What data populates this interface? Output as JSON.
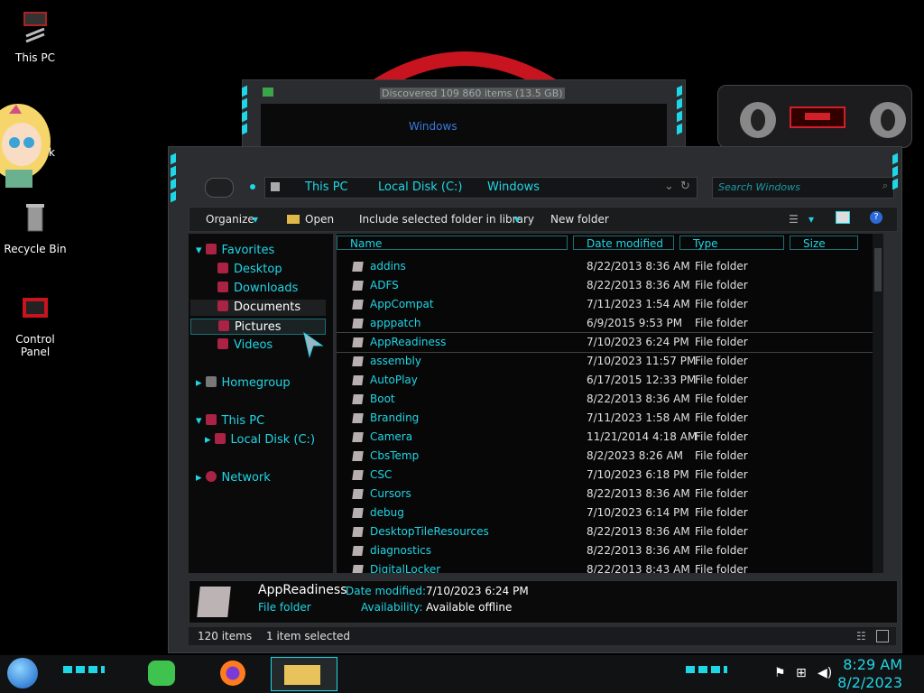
{
  "desktop": {
    "icons": [
      {
        "label": "This PC"
      },
      {
        "label": "k"
      },
      {
        "label": "Recycle Bin"
      },
      {
        "label": "Control Panel"
      }
    ]
  },
  "bg_window": {
    "status_text": "Discovered 109 860 items (13.5 GB)",
    "breadcrumb": "Windows"
  },
  "explorer": {
    "address": {
      "crumbs": [
        "This PC",
        "Local Disk (C:)",
        "Windows"
      ]
    },
    "search": {
      "placeholder": "Search Windows"
    },
    "toolbar": {
      "organize": "Organize",
      "open": "Open",
      "include": "Include selected folder in library",
      "new_folder": "New folder"
    },
    "nav": {
      "favorites": "Favorites",
      "desktop": "Desktop",
      "downloads": "Downloads",
      "documents": "Documents",
      "pictures": "Pictures",
      "videos": "Videos",
      "homegroup": "Homegroup",
      "this_pc": "This PC",
      "local_disk": "Local Disk (C:)",
      "network": "Network"
    },
    "columns": {
      "name": "Name",
      "date": "Date modified",
      "type": "Type",
      "size": "Size"
    },
    "rows": [
      {
        "name": "addins",
        "date": "8/22/2013 8:36 AM",
        "type": "File folder"
      },
      {
        "name": "ADFS",
        "date": "8/22/2013 8:36 AM",
        "type": "File folder"
      },
      {
        "name": "AppCompat",
        "date": "7/11/2023 1:54 AM",
        "type": "File folder"
      },
      {
        "name": "apppatch",
        "date": "6/9/2015 9:53 PM",
        "type": "File folder"
      },
      {
        "name": "AppReadiness",
        "date": "7/10/2023 6:24 PM",
        "type": "File folder"
      },
      {
        "name": "assembly",
        "date": "7/10/2023 11:57 PM",
        "type": "File folder"
      },
      {
        "name": "AutoPlay",
        "date": "6/17/2015 12:33 PM",
        "type": "File folder"
      },
      {
        "name": "Boot",
        "date": "8/22/2013 8:36 AM",
        "type": "File folder"
      },
      {
        "name": "Branding",
        "date": "7/11/2023 1:58 AM",
        "type": "File folder"
      },
      {
        "name": "Camera",
        "date": "11/21/2014 4:18 AM",
        "type": "File folder"
      },
      {
        "name": "CbsTemp",
        "date": "8/2/2023 8:26 AM",
        "type": "File folder"
      },
      {
        "name": "CSC",
        "date": "7/10/2023 6:18 PM",
        "type": "File folder"
      },
      {
        "name": "Cursors",
        "date": "8/22/2013 8:36 AM",
        "type": "File folder"
      },
      {
        "name": "debug",
        "date": "7/10/2023 6:14 PM",
        "type": "File folder"
      },
      {
        "name": "DesktopTileResources",
        "date": "8/22/2013 8:36 AM",
        "type": "File folder"
      },
      {
        "name": "diagnostics",
        "date": "8/22/2013 8:36 AM",
        "type": "File folder"
      },
      {
        "name": "DigitalLocker",
        "date": "8/22/2013 8:43 AM",
        "type": "File folder"
      }
    ],
    "details": {
      "name": "AppReadiness",
      "kind": "File folder",
      "date_label": "Date modified:",
      "date_value": "7/10/2023 6:24 PM",
      "avail_label": "Availability:",
      "avail_value": "Available offline"
    },
    "status": {
      "count": "120 items",
      "selected": "1 item selected"
    }
  },
  "taskbar": {
    "time": "8:29 AM",
    "date": "8/2/2023"
  },
  "colors": {
    "accent": "#1fd6e6",
    "window": "#2b2d30",
    "red": "#d0202a"
  }
}
